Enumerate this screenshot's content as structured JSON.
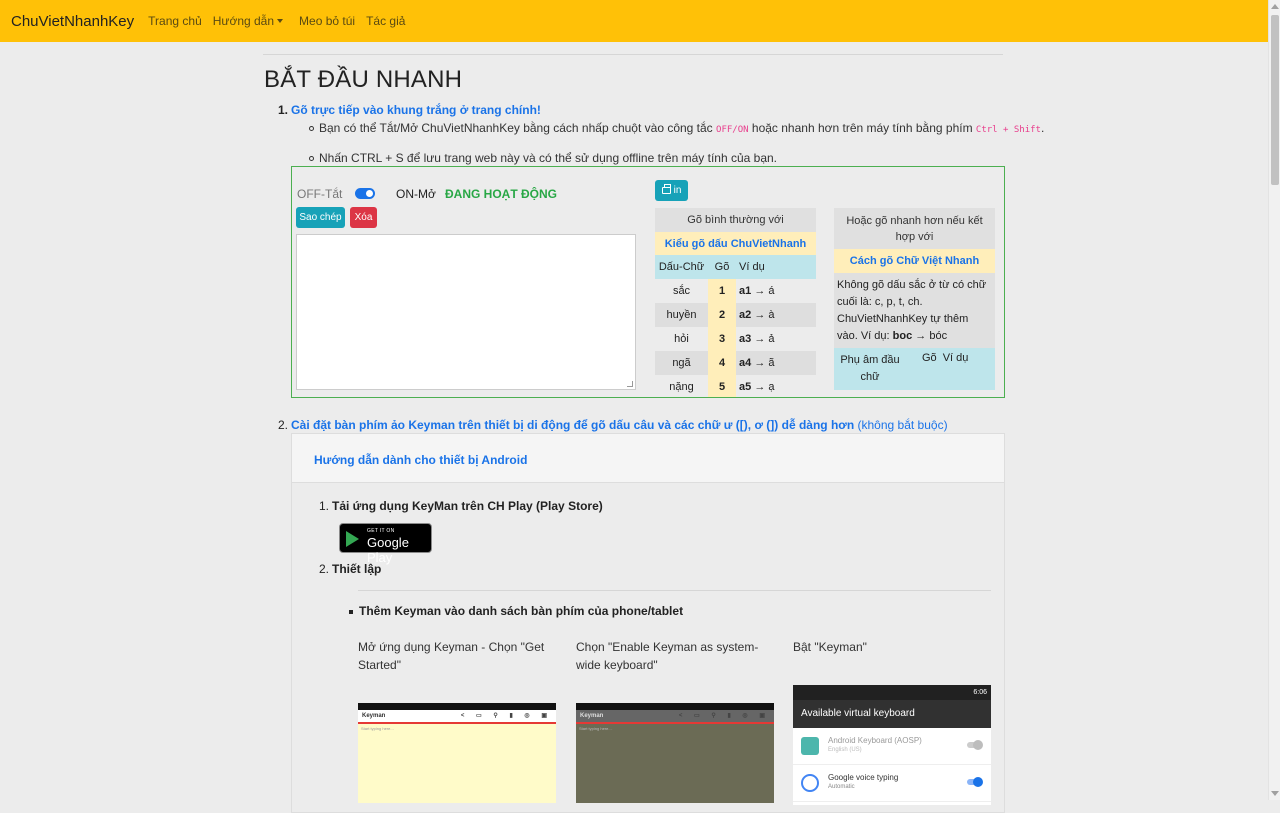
{
  "navbar": {
    "brand": "ChuVietNhanhKey",
    "links": [
      "Trang chủ",
      "Hướng dẫn",
      "Meo bỏ túi",
      "Tác giả"
    ],
    "bg_color": "#ffc107"
  },
  "page_title": "BẮT ĐẦU NHANH",
  "step1": {
    "num": "1.",
    "title": "Gõ trực tiếp vào khung trắng ở trang chính!",
    "bullet1_a": "Bạn có thể Tắt/Mở ChuVietNhanhKey bằng cách nhấp chuột vào công tắc",
    "bullet1_code1": "OFF/ON",
    "bullet1_b": "hoặc nhanh hơn trên máy tính bằng phím",
    "bullet1_code2": "Ctrl + Shift",
    "bullet1_c": ".",
    "bullet2": "Nhấn CTRL + S để lưu trang web này và có thể sử dụng offline trên máy tính của bạn."
  },
  "tool": {
    "off_label": "OFF-Tắt",
    "on_label": "ON-Mở",
    "status": "ĐANG HOẠT ĐỘNG",
    "copy_btn": "Sao chép",
    "delete_btn": "Xóa",
    "print_btn": "in",
    "textarea_value": ""
  },
  "table1": {
    "header": "Gõ bình thường với",
    "subheader": "Kiểu gõ dấu ChuVietNhanh",
    "cols": [
      "Dấu-Chữ",
      "Gõ",
      "Ví dụ"
    ],
    "rows": [
      {
        "mark": "sắc",
        "key": "1",
        "ex_in": "a1",
        "ex_out": "→ á"
      },
      {
        "mark": "huyền",
        "key": "2",
        "ex_in": "a2",
        "ex_out": "→ à"
      },
      {
        "mark": "hỏi",
        "key": "3",
        "ex_in": "a3",
        "ex_out": "→ ả"
      },
      {
        "mark": "ngã",
        "key": "4",
        "ex_in": "a4",
        "ex_out": "→ ã"
      },
      {
        "mark": "nặng",
        "key": "5",
        "ex_in": "a5",
        "ex_out": "→ ạ"
      }
    ]
  },
  "table2": {
    "header": "Hoặc gõ nhanh hơn nếu kết hợp với",
    "subheader": "Cách gõ Chữ Việt Nhanh",
    "body_a": "Không gõ dấu sắc ở từ có chữ cuối là: c, p, t, ch. ChuVietNhanhKey tự thêm vào. Ví dụ:",
    "body_bold": "boc",
    "body_b": "→ bóc",
    "cols": [
      "Phụ âm đầu chữ",
      "Gõ",
      "Ví dụ"
    ]
  },
  "step2": {
    "num": "2.",
    "title": "Cài đặt bàn phím ảo Keyman trên thiết bị di động để gõ dấu câu và các chữ ư ([), ơ (]) dễ dàng hơn",
    "optional": "(không bắt buộc)",
    "card_header": "Hướng dẫn dành cho thiết bị Android",
    "sub1_num": "1.",
    "sub1_title": "Tải ứng dụng KeyMan trên CH Play (Play Store)",
    "gplay_small": "GET IT ON",
    "gplay_big": "Google Play",
    "sub2_num": "2.",
    "sub2_title": "Thiết lập",
    "bullet": "Thêm Keyman vào danh sách bàn phím của phone/tablet",
    "col1": "Mở ứng dụng Keyman - Chọn \"Get Started\"",
    "col2": "Chọn \"Enable Keyman as system-wide keyboard\"",
    "col3": "Bật \"Keyman\"",
    "phone1": {
      "app": "Keyman",
      "hint": "Start typing here..."
    },
    "phone2": {
      "app": "Keyman",
      "hint": "Start typing here..."
    },
    "phone3": {
      "time": "6:06",
      "title": "Available virtual keyboard",
      "items": [
        {
          "name": "Android Keyboard (AOSP)",
          "sub": "English (US)",
          "on": false
        },
        {
          "name": "Google voice typing",
          "sub": "Automatic",
          "on": true
        }
      ]
    }
  }
}
